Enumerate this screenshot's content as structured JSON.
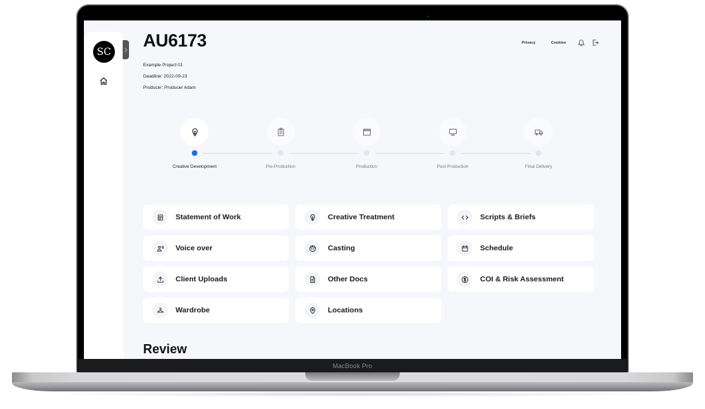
{
  "device": {
    "label": "MacBook Pro"
  },
  "sidebar": {
    "avatar_initials": "SC",
    "items": [
      {
        "name": "home",
        "icon": "home-icon"
      }
    ],
    "collapse_icon": "chevron-right-icon"
  },
  "header": {
    "title": "AU6173",
    "project": "Example Project 01",
    "deadline": "Deadline: 2022-09-23",
    "producer": "Producer: Producer Adam",
    "links": [
      {
        "label": "Privacy"
      },
      {
        "label": "Cookies"
      }
    ],
    "icons": [
      "bell-icon",
      "logout-icon"
    ]
  },
  "stepper": {
    "active_index": 0,
    "steps": [
      {
        "label": "Creative Development",
        "icon": "lightbulb-icon"
      },
      {
        "label": "Pre-Production",
        "icon": "clipboard-icon"
      },
      {
        "label": "Production",
        "icon": "clapperboard-icon"
      },
      {
        "label": "Post-Production",
        "icon": "monitor-icon"
      },
      {
        "label": "Final Delivery",
        "icon": "truck-icon"
      }
    ]
  },
  "cards": [
    {
      "label": "Statement of Work",
      "icon": "document-icon"
    },
    {
      "label": "Creative Treatment",
      "icon": "lightbulb-icon"
    },
    {
      "label": "Scripts & Briefs",
      "icon": "code-icon"
    },
    {
      "label": "Voice over",
      "icon": "voice-icon"
    },
    {
      "label": "Casting",
      "icon": "face-icon"
    },
    {
      "label": "Schedule",
      "icon": "calendar-icon"
    },
    {
      "label": "Client Uploads",
      "icon": "upload-icon"
    },
    {
      "label": "Other Docs",
      "icon": "file-icon"
    },
    {
      "label": "COI & Risk Assessment",
      "icon": "dollar-circle-icon"
    },
    {
      "label": "Wardrobe",
      "icon": "hanger-icon"
    },
    {
      "label": "Locations",
      "icon": "location-pin-icon"
    }
  ],
  "sections": {
    "review_title": "Review"
  }
}
